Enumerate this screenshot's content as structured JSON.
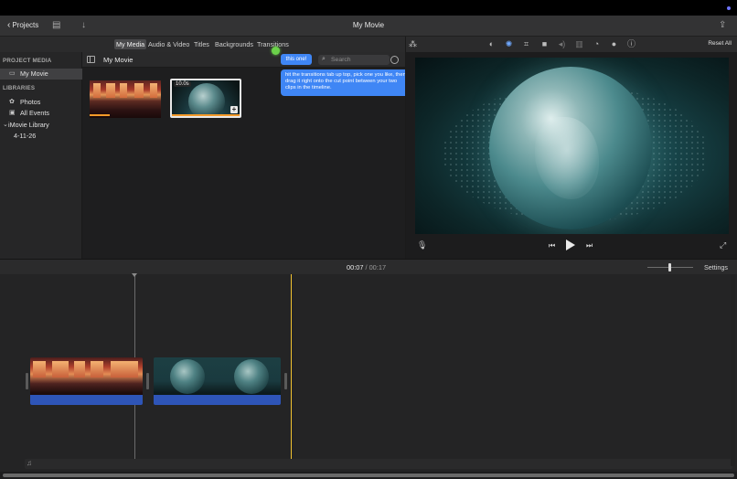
{
  "titlebar": {
    "back_label": "Projects",
    "window_title": "My Movie"
  },
  "media_tabs": [
    {
      "label": "My Media",
      "active": true
    },
    {
      "label": "Audio & Video",
      "active": false
    },
    {
      "label": "Titles",
      "active": false
    },
    {
      "label": "Backgrounds",
      "active": false
    },
    {
      "label": "Transitions",
      "active": false
    }
  ],
  "viewer_toolbar": {
    "icons": [
      "magic-wand-icon",
      "color-balance-icon",
      "color-correction-icon",
      "crop-icon",
      "stabilization-icon",
      "volume-icon",
      "noise-reduction-icon",
      "speed-icon",
      "clip-filter-icon",
      "info-icon"
    ],
    "reset_label": "Reset All"
  },
  "sidebar": {
    "project_media_header": "PROJECT MEDIA",
    "project_item": "My Movie",
    "libraries_header": "LIBRARIES",
    "library_items": [
      "Photos",
      "All Events"
    ],
    "library_name": "iMovie Library",
    "event_name": "4-11-26"
  },
  "browser": {
    "title": "My Movie",
    "search_placeholder": "Search",
    "clip2_duration": "10.0s"
  },
  "tooltips": {
    "small": "this one!",
    "big": "hit the transitions tab up top, pick one you like, then drag it right onto the cut point between your two clips in the timeline."
  },
  "timeline": {
    "current_time": "00:07",
    "separator": "/",
    "total_time": "00:17",
    "settings_label": "Settings"
  },
  "colors": {
    "accent_blue": "#3f86f5",
    "playhead": "#f2c230",
    "audio_track": "#2e55b8",
    "cursor_highlight": "#6bd14a"
  }
}
